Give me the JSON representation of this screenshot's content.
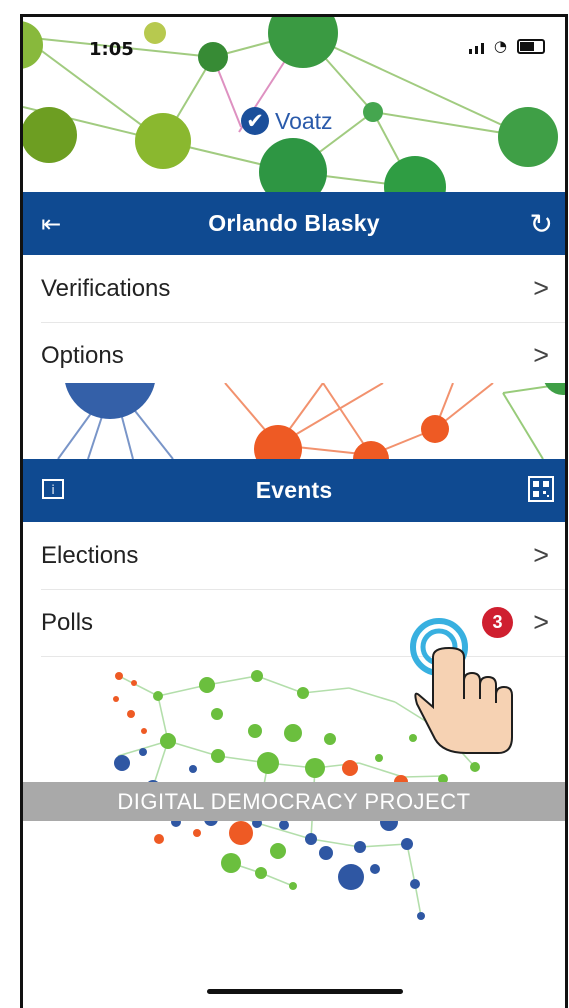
{
  "status_bar": {
    "time": "1:05"
  },
  "logo": {
    "text": "Voatz"
  },
  "profile_header": {
    "title": "Orlando Blasky",
    "logout_icon": "logout-icon",
    "refresh_icon": "refresh-icon"
  },
  "profile_menu": [
    {
      "label": "Verifications",
      "chevron": ">"
    },
    {
      "label": "Options",
      "chevron": ">"
    }
  ],
  "events_header": {
    "title": "Events",
    "info_icon": "info-icon",
    "qr_icon": "qr-code-icon"
  },
  "events_menu": [
    {
      "label": "Elections",
      "chevron": ">"
    },
    {
      "label": "Polls",
      "badge": "3",
      "chevron": ">"
    }
  ],
  "banner": {
    "text": "DIGITAL DEMOCRACY PROJECT"
  },
  "colors": {
    "header_blue": "#0f4a91",
    "badge_red": "#cf1f2f",
    "green": "#3f9f46",
    "orange": "#ee5a24",
    "blue": "#2f5ca2"
  }
}
